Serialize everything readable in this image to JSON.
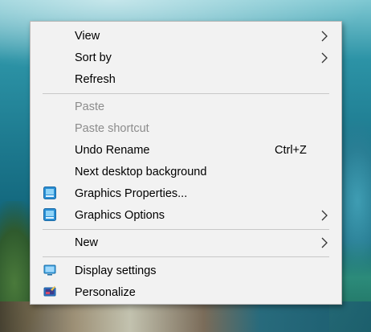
{
  "context_menu": {
    "items": [
      {
        "label": "View",
        "submenu": true
      },
      {
        "label": "Sort by",
        "submenu": true
      },
      {
        "label": "Refresh"
      },
      {
        "label": "Paste",
        "disabled": true
      },
      {
        "label": "Paste shortcut",
        "disabled": true
      },
      {
        "label": "Undo Rename",
        "shortcut": "Ctrl+Z"
      },
      {
        "label": "Next desktop background"
      },
      {
        "label": "Graphics Properties...",
        "icon": "intel-graphics-icon"
      },
      {
        "label": "Graphics Options",
        "icon": "intel-graphics-icon",
        "submenu": true
      },
      {
        "label": "New",
        "submenu": true
      },
      {
        "label": "Display settings",
        "icon": "display-settings-icon"
      },
      {
        "label": "Personalize",
        "icon": "personalize-icon"
      }
    ]
  },
  "colors": {
    "menu_background": "#f2f2f2",
    "disabled_text": "#8c8c8c",
    "separator": "#c8c8c8"
  }
}
